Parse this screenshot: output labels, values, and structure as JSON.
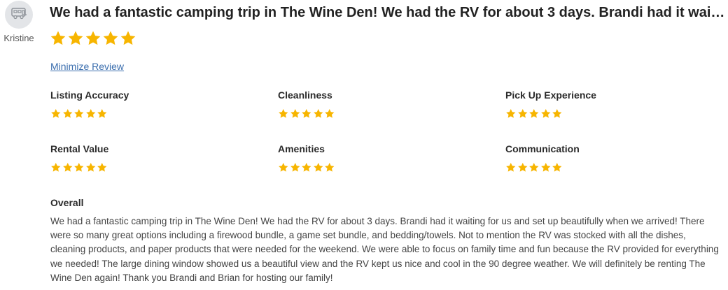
{
  "reviewer": {
    "name": "Kristine",
    "avatar_icon": "rv-camper-icon"
  },
  "review": {
    "title": "We had a fantastic camping trip in The Wine Den! We had the RV for about 3 days. Brandi had it waiting for…",
    "rating": 5,
    "rating_max": 5,
    "minimize_label": "Minimize Review"
  },
  "categories": [
    {
      "label": "Listing Accuracy",
      "rating": 5
    },
    {
      "label": "Cleanliness",
      "rating": 5
    },
    {
      "label": "Pick Up Experience",
      "rating": 5
    },
    {
      "label": "Rental Value",
      "rating": 5
    },
    {
      "label": "Amenities",
      "rating": 5
    },
    {
      "label": "Communication",
      "rating": 5
    }
  ],
  "overall": {
    "label": "Overall",
    "text": "We had a fantastic camping trip in The Wine Den! We had the RV for about 3 days. Brandi had it waiting for us and set up beautifully when we arrived! There were so many great options including a firewood bundle, a game set bundle, and bedding/towels. Not to mention the RV was stocked with all the dishes, cleaning products, and paper products that were needed for the weekend. We were able to focus on family time and fun because the RV provided for everything we needed! The large dining window showed us a beautiful view and the RV kept us nice and cool in the 90 degree weather. We will definitely be renting The Wine Den again! Thank you Brandi and Brian for hosting our family!"
  },
  "colors": {
    "star": "#f7b500",
    "link": "#3b6eae"
  }
}
